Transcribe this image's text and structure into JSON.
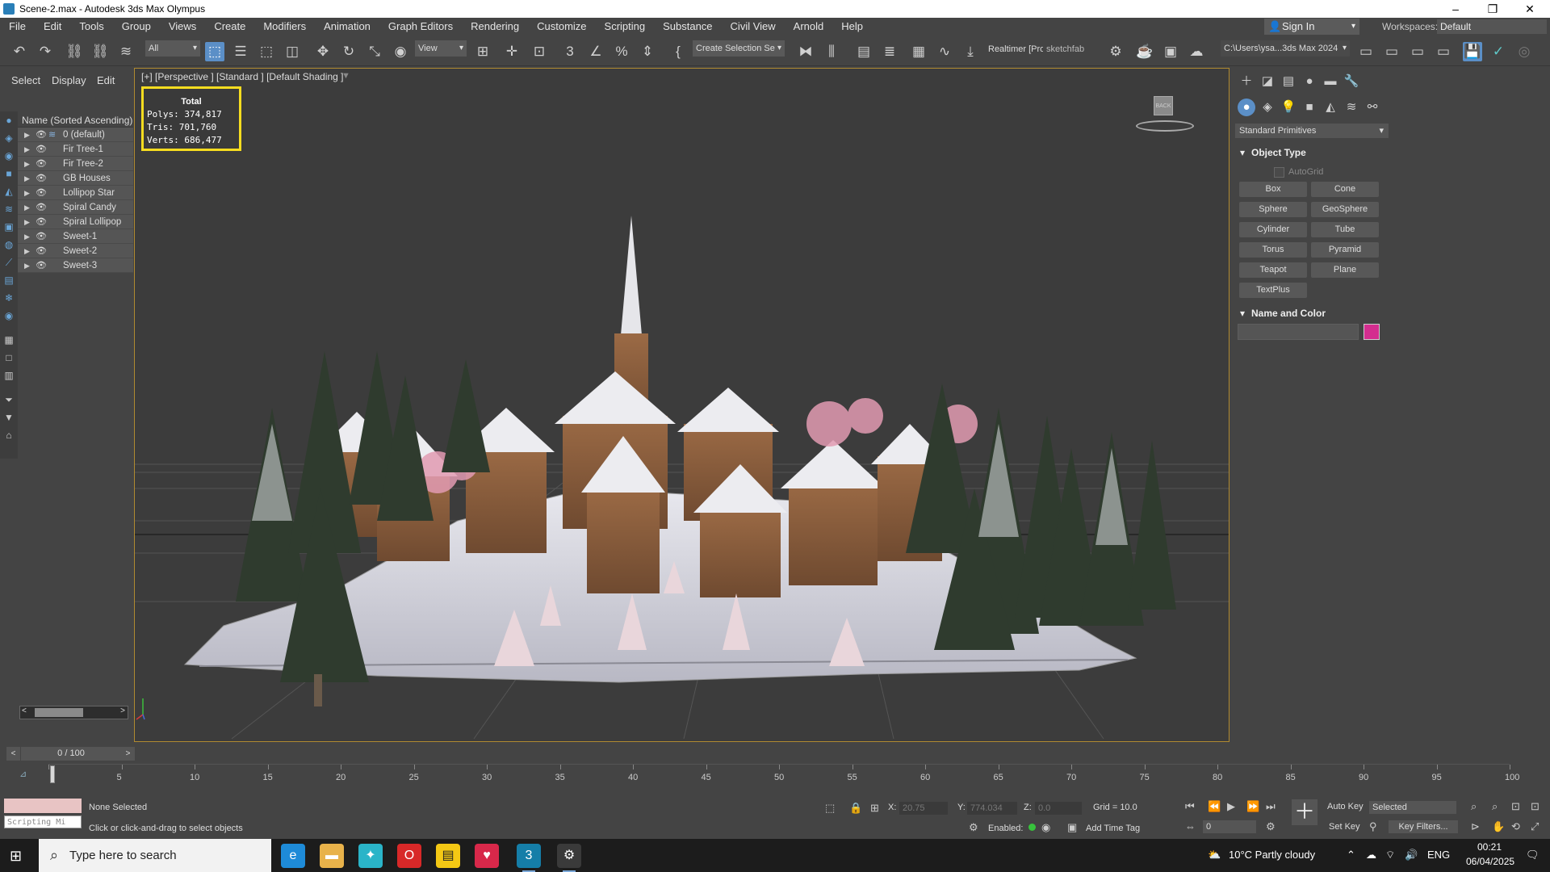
{
  "window": {
    "title": "Scene-2.max - Autodesk 3ds Max Olympus",
    "controls": [
      "–",
      "❐",
      "✕"
    ]
  },
  "menu": [
    "File",
    "Edit",
    "Tools",
    "Group",
    "Views",
    "Create",
    "Modifiers",
    "Animation",
    "Graph Editors",
    "Rendering",
    "Customize",
    "Scripting",
    "Substance",
    "Civil View",
    "Arnold",
    "Help"
  ],
  "header": {
    "sign_in": "Sign In",
    "workspaces_label": "Workspaces:",
    "workspace_value": "Default"
  },
  "toolbar": {
    "filter_all": "All",
    "ref_coord": "View",
    "selection_set": "Create Selection Se",
    "realtimer": "Realtimer [Pro",
    "sketchfab": "sketchfab",
    "path": "C:\\Users\\ysa...3ds Max 2024"
  },
  "explorer": {
    "tabs": [
      "Select",
      "Display",
      "Edit"
    ],
    "header": "Name (Sorted Ascending)",
    "items": [
      {
        "name": "0 (default)"
      },
      {
        "name": "Fir Tree-1"
      },
      {
        "name": "Fir Tree-2"
      },
      {
        "name": "GB Houses"
      },
      {
        "name": "Lollipop Star"
      },
      {
        "name": "Spiral Candy"
      },
      {
        "name": "Spiral Lollipop"
      },
      {
        "name": "Sweet-1"
      },
      {
        "name": "Sweet-2"
      },
      {
        "name": "Sweet-3"
      }
    ]
  },
  "viewport": {
    "label": "[+] [Perspective ] [Standard ] [Default Shading ]",
    "viewcube_face": "BACK",
    "stats": {
      "title": "Total",
      "polys_label": "Polys:",
      "polys": "374,817",
      "tris_label": "Tris:",
      "tris": "701,760",
      "verts_label": "Verts:",
      "verts": "686,477"
    }
  },
  "command_panel": {
    "category": "Standard Primitives",
    "object_type_title": "Object Type",
    "autogrid": "AutoGrid",
    "primitives": [
      "Box",
      "Cone",
      "Sphere",
      "GeoSphere",
      "Cylinder",
      "Tube",
      "Torus",
      "Pyramid",
      "Teapot",
      "Plane",
      "TextPlus"
    ],
    "name_color_title": "Name and Color",
    "swatch_color": "#d42d8f"
  },
  "timeline": {
    "frame_display": "0 / 100",
    "ticks": [
      0,
      5,
      10,
      15,
      20,
      25,
      30,
      35,
      40,
      45,
      50,
      55,
      60,
      65,
      70,
      75,
      80,
      85,
      90,
      95,
      100
    ]
  },
  "status": {
    "scripting_placeholder": "Scripting Mi",
    "selection": "None Selected",
    "prompt": "Click or click-and-drag to select objects",
    "x_label": "X:",
    "x_value": "20.75",
    "y_label": "Y:",
    "y_value": "774.034",
    "z_label": "Z:",
    "z_value": "0.0",
    "grid": "Grid = 10.0",
    "enabled": "Enabled:",
    "add_time_tag": "Add Time Tag",
    "auto_key": "Auto Key",
    "set_key": "Set Key",
    "selected_dd": "Selected",
    "key_filters": "Key Filters...",
    "frame_spinner": "0"
  },
  "taskbar": {
    "search_placeholder": "Type here to search",
    "weather": "10°C  Partly cloudy",
    "lang": "ENG",
    "time": "00:21",
    "date": "06/04/2025"
  }
}
